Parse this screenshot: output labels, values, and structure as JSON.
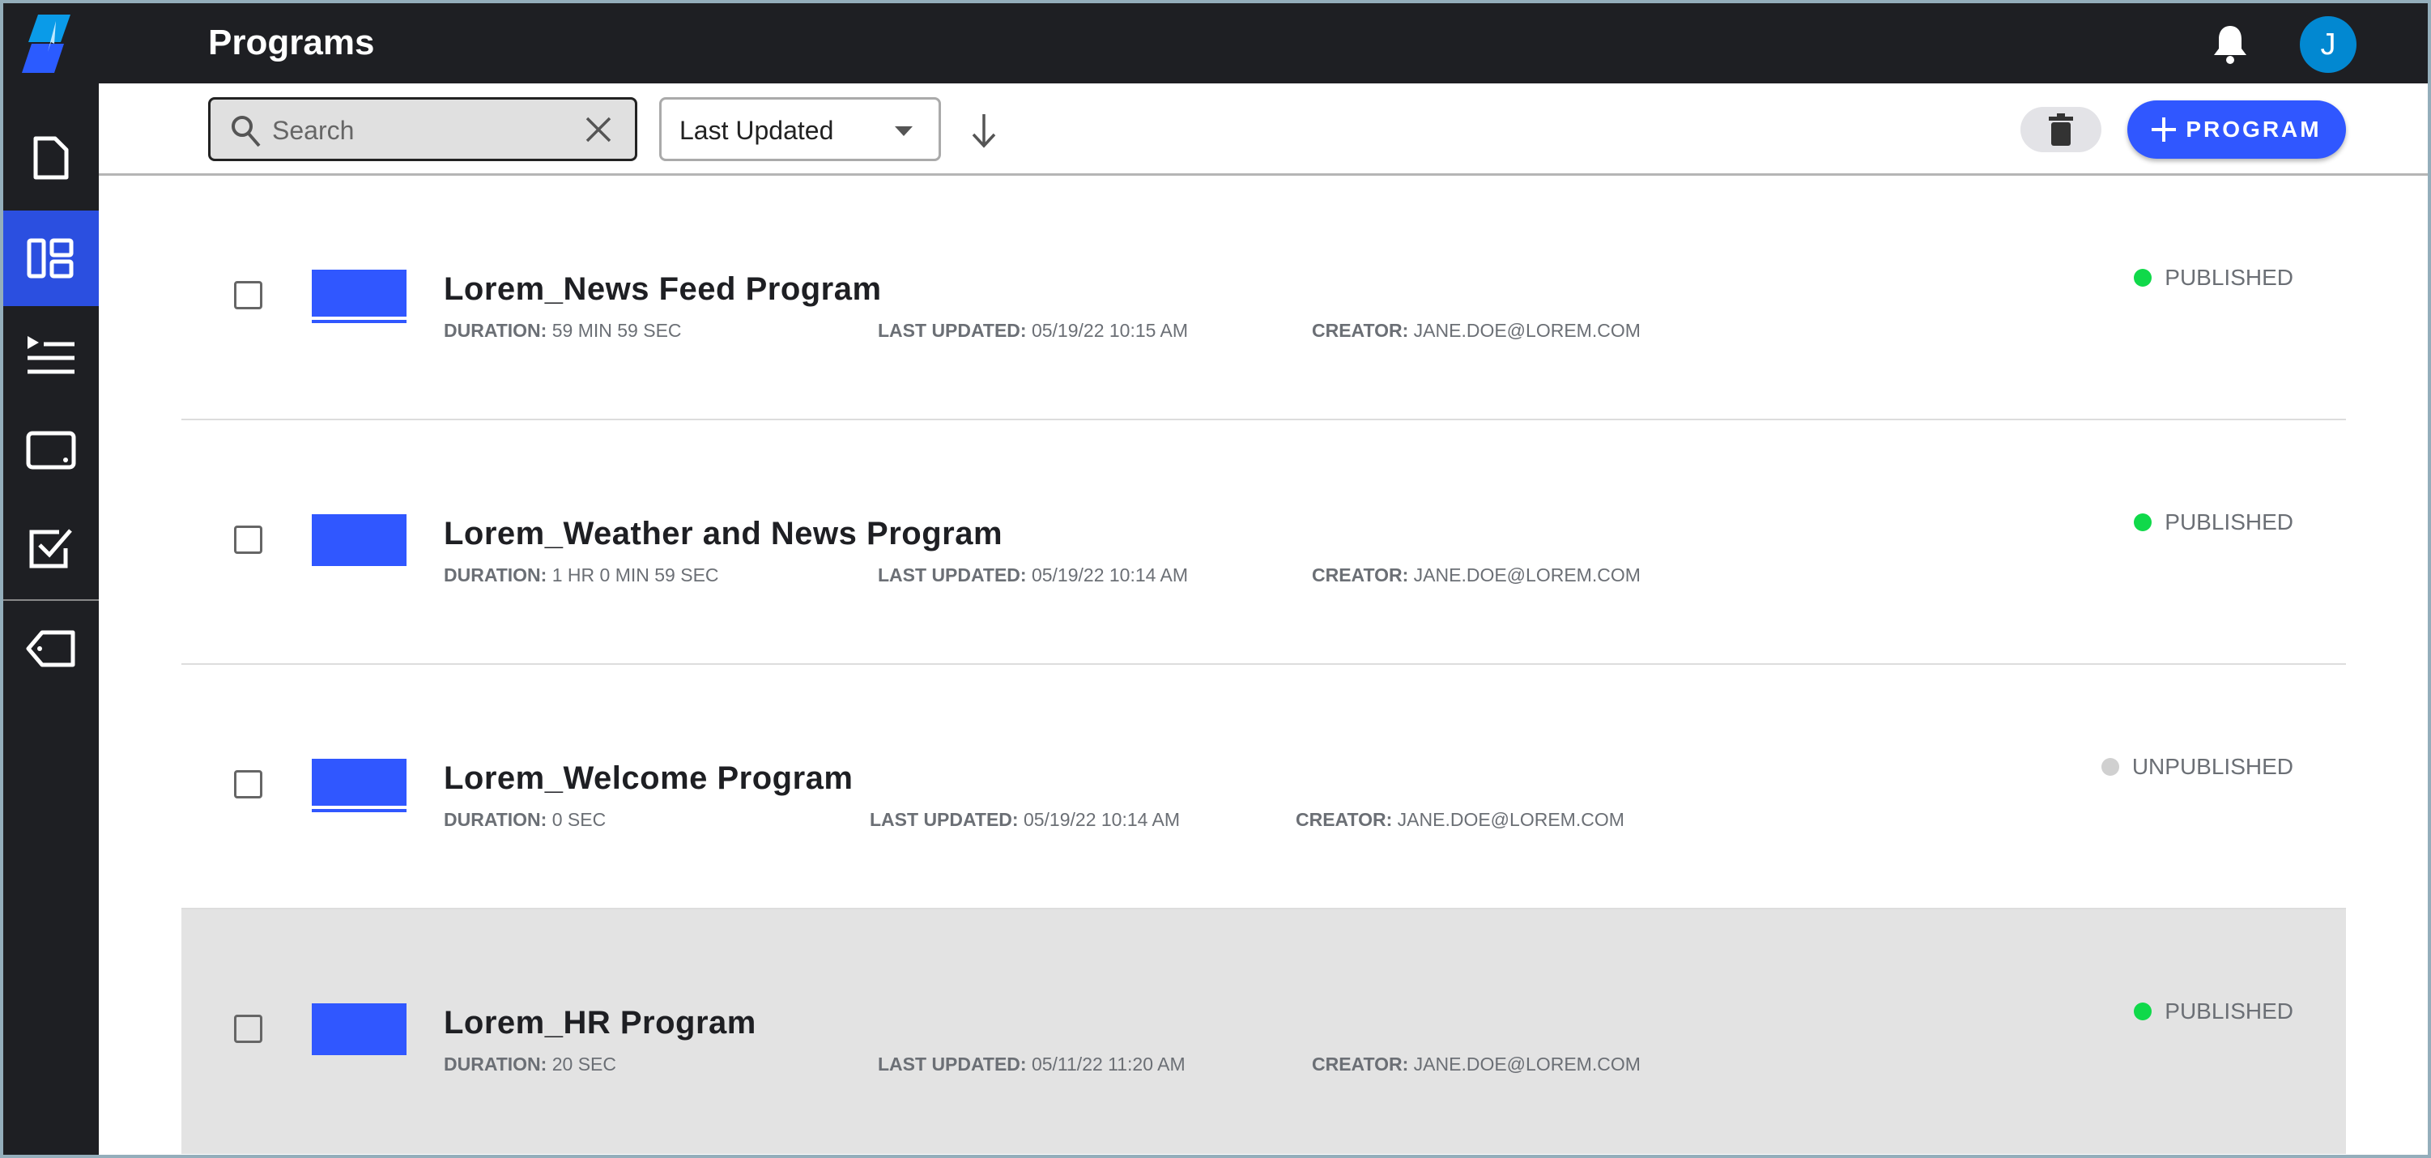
{
  "header": {
    "title": "Programs",
    "avatar_initial": "J"
  },
  "toolbar": {
    "search_placeholder": "Search",
    "sort_value": "Last Updated",
    "add_label": "PROGRAM"
  },
  "colors": {
    "accent": "#3057ff",
    "published": "#10d94a",
    "unpublished": "#d0d0d0",
    "avatar": "#0288d1"
  },
  "meta_labels": {
    "duration": "DURATION:",
    "updated": "LAST UPDATED:",
    "creator": "CREATOR:"
  },
  "programs": [
    {
      "title": "Lorem_News Feed Program",
      "duration": "59 MIN 59 SEC",
      "updated": "05/19/22 10:15 AM",
      "creator": "JANE.DOE@LOREM.COM",
      "status": "PUBLISHED"
    },
    {
      "title": "Lorem_Weather and News Program",
      "duration": "1 HR 0 MIN 59 SEC",
      "updated": "05/19/22 10:14 AM",
      "creator": "JANE.DOE@LOREM.COM",
      "status": "PUBLISHED"
    },
    {
      "title": "Lorem_Welcome Program",
      "duration": "0 SEC",
      "updated": "05/19/22 10:14 AM",
      "creator": "JANE.DOE@LOREM.COM",
      "status": "UNPUBLISHED"
    },
    {
      "title": "Lorem_HR Program",
      "duration": "20 SEC",
      "updated": "05/11/22 11:20 AM",
      "creator": "JANE.DOE@LOREM.COM",
      "status": "PUBLISHED"
    }
  ]
}
